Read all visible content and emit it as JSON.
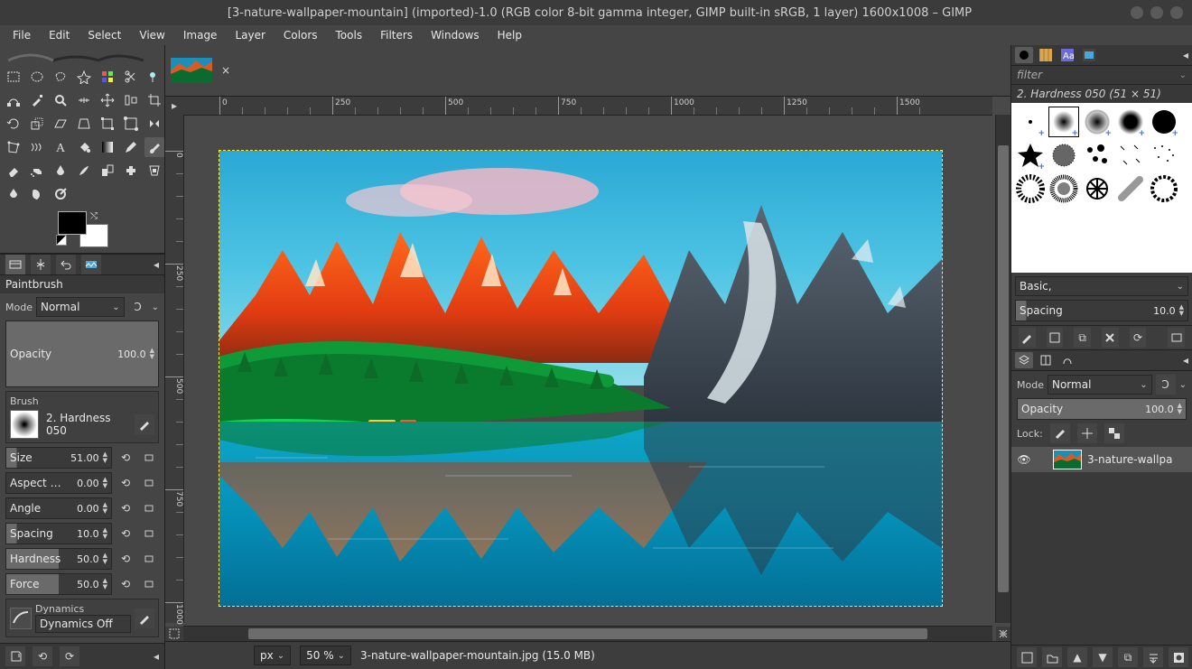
{
  "title": "[3-nature-wallpaper-mountain] (imported)-1.0 (RGB color 8-bit gamma integer, GIMP built-in sRGB, 1 layer) 1600x1008 – GIMP",
  "menus": [
    "File",
    "Edit",
    "Select",
    "View",
    "Image",
    "Layer",
    "Colors",
    "Tools",
    "Filters",
    "Windows",
    "Help"
  ],
  "tool_options": {
    "title": "Paintbrush",
    "mode_label": "Mode",
    "mode_value": "Normal",
    "opacity_label": "Opacity",
    "opacity_value": "100.0",
    "brush_label": "Brush",
    "brush_name": "2. Hardness 050",
    "sliders": [
      {
        "label": "Size",
        "value": "51.00"
      },
      {
        "label": "Aspect …",
        "value": "0.00"
      },
      {
        "label": "Angle",
        "value": "0.00"
      },
      {
        "label": "Spacing",
        "value": "10.0"
      },
      {
        "label": "Hardness",
        "value": "50.0"
      },
      {
        "label": "Force",
        "value": "50.0"
      }
    ],
    "dynamics_label": "Dynamics",
    "dynamics_value": "Dynamics Off"
  },
  "status": {
    "unit": "px",
    "zoom": "50 %",
    "file": "3-nature-wallpaper-mountain.jpg (15.0 MB)"
  },
  "brushes": {
    "filter_placeholder": "filter",
    "title": "2. Hardness 050 (51 × 51)",
    "preset_label": "Basic,",
    "spacing_label": "Spacing",
    "spacing_value": "10.0"
  },
  "layers": {
    "mode_label": "Mode",
    "mode_value": "Normal",
    "opacity_label": "Opacity",
    "opacity_value": "100.0",
    "lock_label": "Lock:",
    "layer_name": "3-nature-wallpa"
  },
  "ruler_h": [
    "250",
    "500",
    "750",
    "1000",
    "1250",
    "1500"
  ],
  "ruler_v": [
    "0",
    "250",
    "500",
    "750",
    "1000"
  ],
  "icons": {
    "close": "×",
    "chev": "⌄",
    "reset": "⟲",
    "link": "🔗",
    "new": "▫",
    "eye": "👁",
    "anchor": "⚓",
    "dup": "⧉",
    "del": "🗑",
    "up": "▲",
    "down": "▼"
  }
}
